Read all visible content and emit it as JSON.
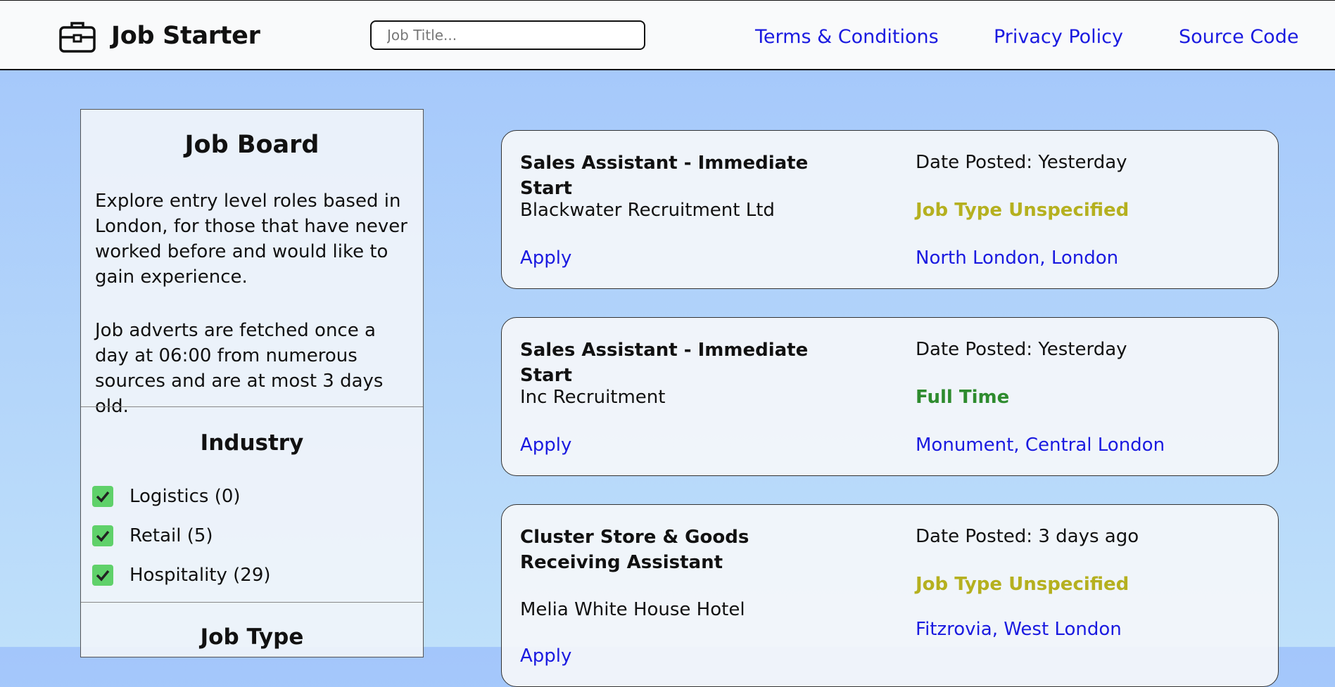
{
  "header": {
    "brand": "Job Starter",
    "logo_icon": "briefcase-icon",
    "search_placeholder": "Job Title...",
    "nav": [
      "Terms & Conditions",
      "Privacy Policy",
      "Source Code"
    ]
  },
  "sidebar": {
    "title": "Job Board",
    "intro": "Explore entry level roles based in London, for those that have never worked before and would like to gain experience.",
    "fetch_note": "Job adverts are fetched once a day at 06:00 from numerous sources and are at most 3 days old.",
    "industry_title": "Industry",
    "industries": [
      {
        "label": "Logistics (0)",
        "checked": true
      },
      {
        "label": "Retail (5)",
        "checked": true
      },
      {
        "label": "Hospitality (29)",
        "checked": true
      }
    ],
    "job_type_title": "Job Type"
  },
  "jobs": [
    {
      "title": "Sales Assistant - Immediate Start",
      "company": "Blackwater Recruitment Ltd",
      "apply": "Apply",
      "date": "Date Posted: Yesterday",
      "job_type": "Job Type Unspecified",
      "location": "North London, London"
    },
    {
      "title": "Sales Assistant - Immediate Start",
      "company": "Inc Recruitment",
      "apply": "Apply",
      "date": "Date Posted: Yesterday",
      "job_type": "Full Time",
      "location": "Monument, Central London"
    },
    {
      "title": "Cluster Store & Goods Receiving Assistant",
      "company": "Melia White House Hotel",
      "apply": "Apply",
      "date": "Date Posted: 3 days ago",
      "job_type": "Job Type Unspecified",
      "location": "Fitzrovia, West London"
    }
  ],
  "colors": {
    "link": "#1a1ae0",
    "job_type_unspecified": "#b5b01f",
    "job_type_full_time": "#2e8b2e",
    "checkbox": "#5fd16a"
  }
}
